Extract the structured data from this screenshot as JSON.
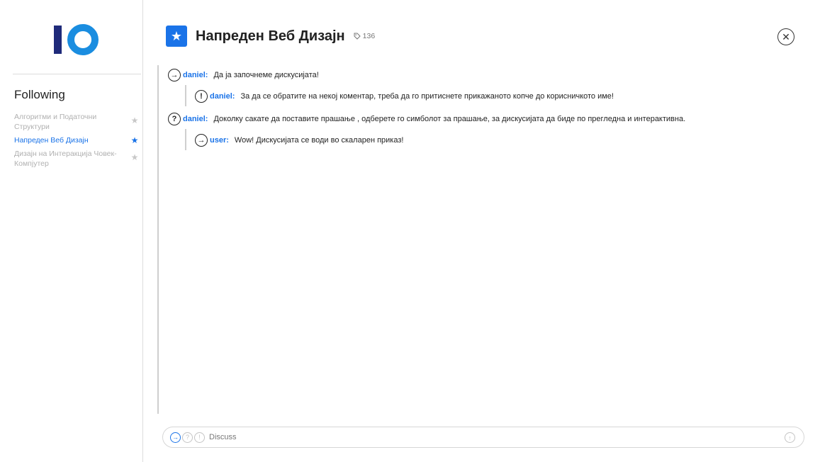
{
  "sidebar": {
    "title": "Following",
    "courses": [
      {
        "label": "Алгоритми и Податочни Структури",
        "starred": false
      },
      {
        "label": "Напреден Веб Дизајн",
        "starred": true
      },
      {
        "label": "Дизајн на Интеракција Човек-Компјутер",
        "starred": false
      }
    ]
  },
  "header": {
    "title": "Напреден Веб Дизајн",
    "tag_count": "136"
  },
  "messages": [
    {
      "type": "statement",
      "icon": "→",
      "author": "daniel:",
      "text": "Да ја започнеме дискусијата!"
    },
    {
      "type": "important",
      "icon": "!",
      "author": "daniel:",
      "text": "За да се обратите на некој коментар, треба да го притиснете прикажаното копче до корисничкото име!"
    },
    {
      "type": "question",
      "icon": "?",
      "author": "daniel:",
      "text": "Доколку сакате да поставите прашање , одберете го симболот за прашање, за дискусијата да биде по прегледна и интерактивна."
    },
    {
      "type": "statement",
      "icon": "→",
      "author": "user:",
      "text": "Wow! Дискусијата се води во скаларен приказ!"
    }
  ],
  "composer": {
    "placeholder": "Discuss",
    "types": [
      "→",
      "?",
      "!"
    ],
    "send_icon": "↑"
  },
  "colors": {
    "accent": "#1a73e8",
    "logo_dark": "#1f2a7a",
    "logo_light": "#1a8de0"
  }
}
